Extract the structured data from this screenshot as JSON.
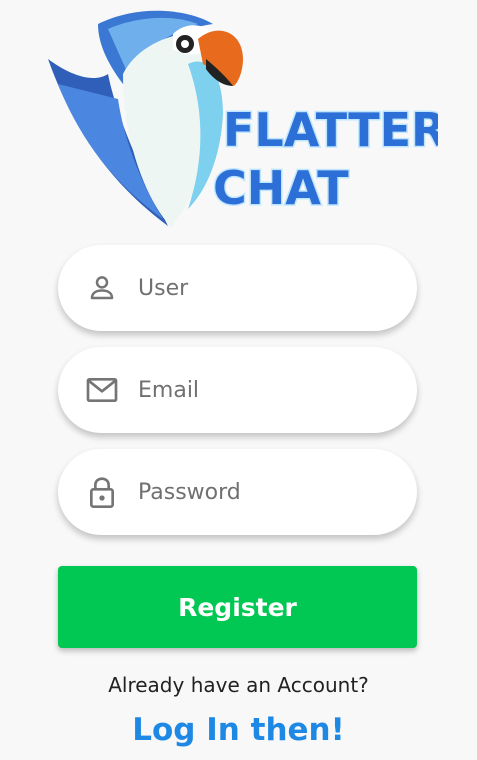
{
  "app": {
    "logo": {
      "line1": "FLATTER",
      "line2": "CHAT",
      "icon": "parrot-logo"
    }
  },
  "form": {
    "user": {
      "placeholder": "User",
      "value": "",
      "icon": "person-icon"
    },
    "email": {
      "placeholder": "Email",
      "value": "",
      "icon": "mail-icon"
    },
    "password": {
      "placeholder": "Password",
      "value": "",
      "icon": "lock-icon"
    }
  },
  "register_button": {
    "label": "Register"
  },
  "login_prompt": {
    "text": "Already have an Account?",
    "link": "Log In then!"
  },
  "colors": {
    "background": "#f8f8f8",
    "register": "#00c853",
    "link": "#1e88e5",
    "logo_text": "#2c6fd6"
  }
}
